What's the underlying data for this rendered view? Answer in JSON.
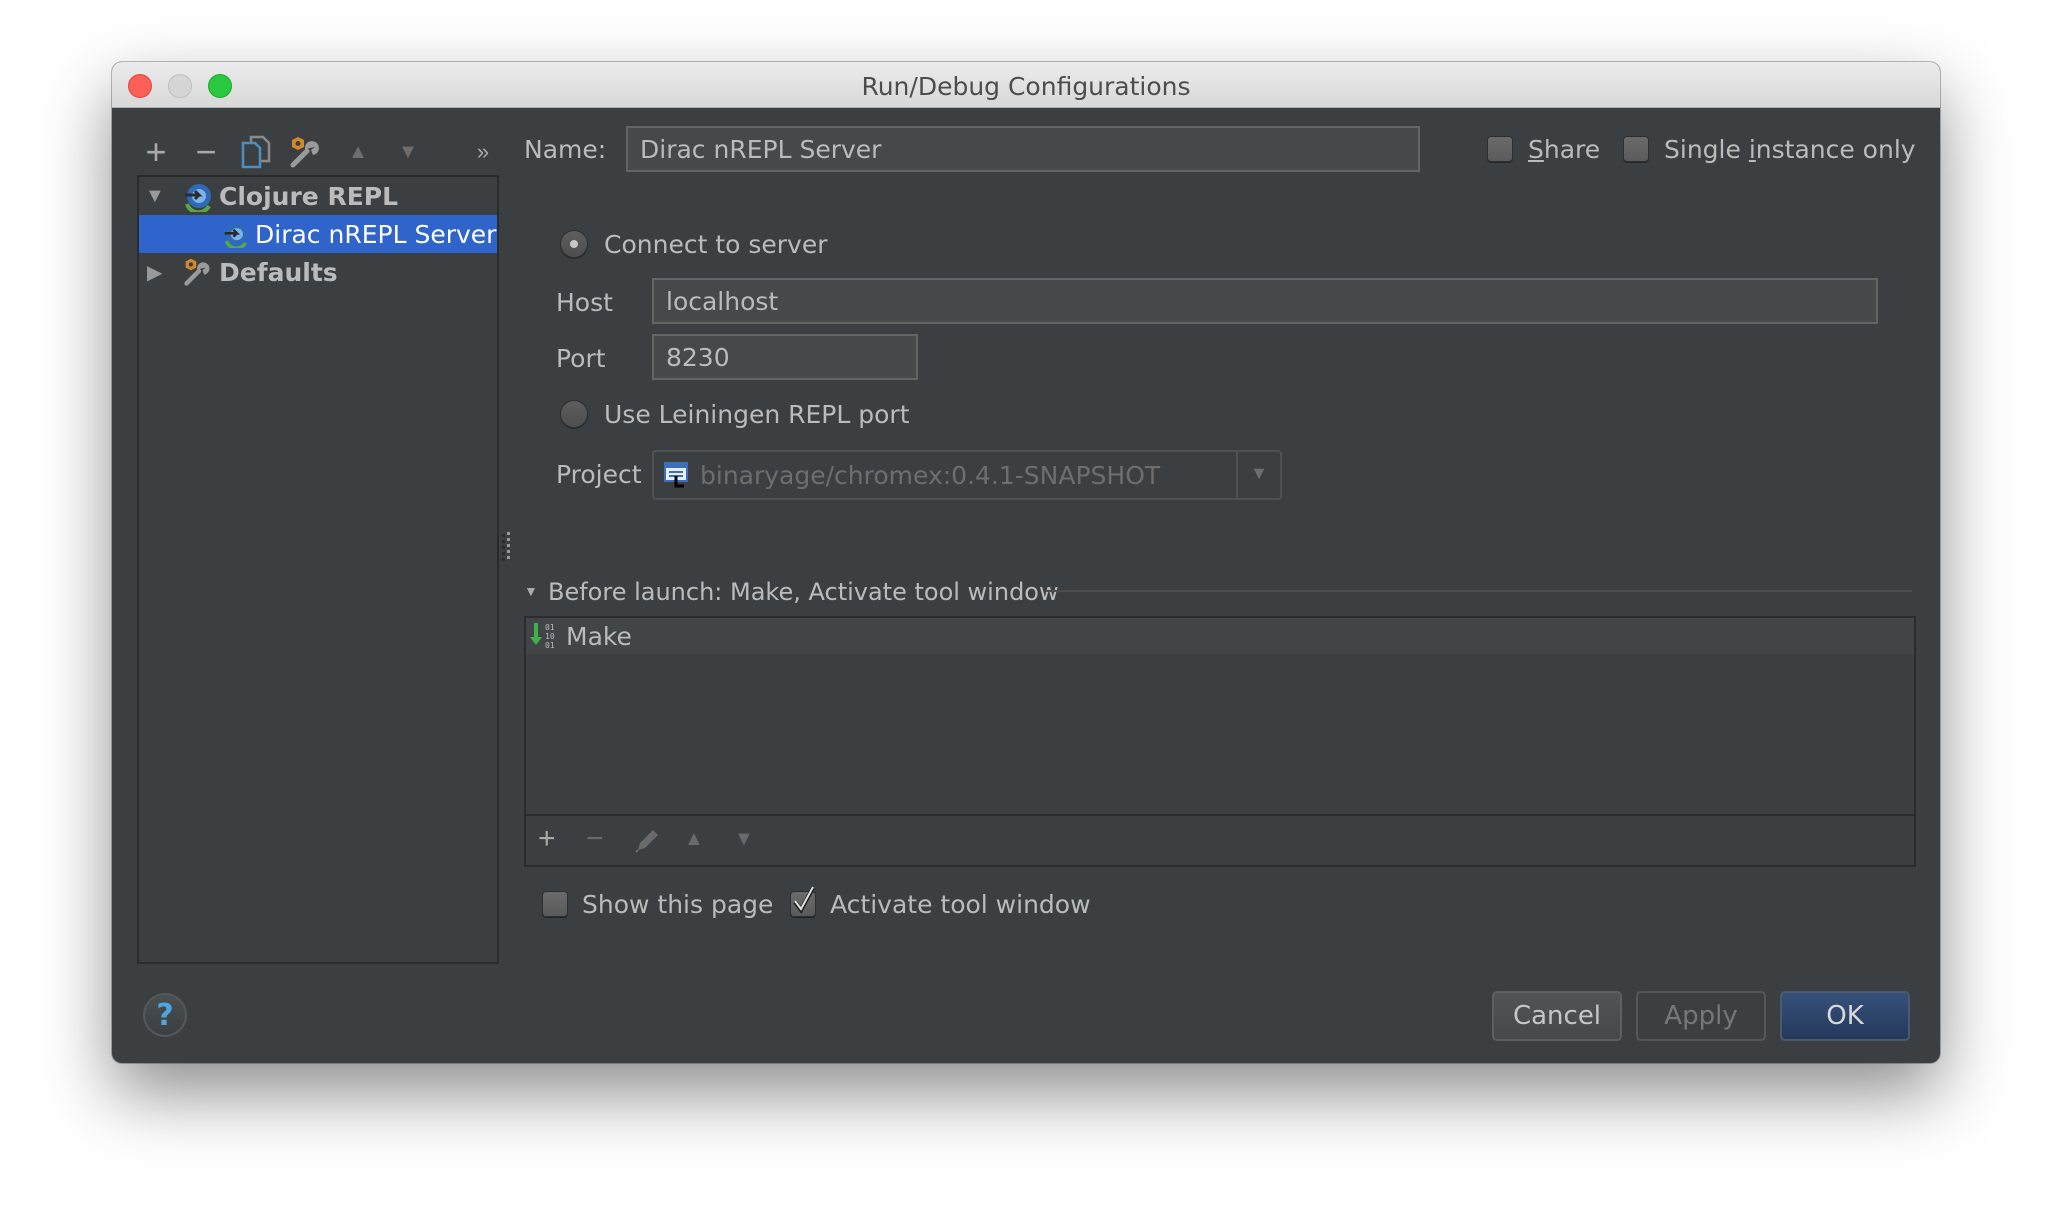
{
  "window": {
    "title": "Run/Debug Configurations"
  },
  "left_toolbar": {
    "items": [
      {
        "name": "add",
        "icon": "plus-icon",
        "glyph": "+"
      },
      {
        "name": "remove",
        "icon": "minus-icon",
        "glyph": "−"
      },
      {
        "name": "copy",
        "icon": "copy-icon"
      },
      {
        "name": "edit-defaults",
        "icon": "wrench-icon"
      },
      {
        "name": "move-up",
        "icon": "arrow-up-icon",
        "glyph": "▲"
      },
      {
        "name": "move-down",
        "icon": "arrow-down-icon",
        "glyph": "▼"
      },
      {
        "name": "more",
        "icon": "chevron-double-right-icon",
        "glyph": "»"
      }
    ]
  },
  "tree": {
    "items": [
      {
        "label": "Clojure REPL",
        "icon": "clojure-repl-icon",
        "expanded": true,
        "bold": true
      },
      {
        "label": "Dirac nREPL Server",
        "icon": "clojure-repl-icon",
        "selected": true
      },
      {
        "label": "Defaults",
        "icon": "wrench-icon",
        "expanded": false,
        "bold": true
      }
    ]
  },
  "form": {
    "name_label": "Name:",
    "name_value": "Dirac nREPL Server",
    "share_label_u": "S",
    "share_label_rest": "hare",
    "share_checked": false,
    "single_instance_label_pre": "Single ",
    "single_instance_label_u": "i",
    "single_instance_label_post": "nstance only",
    "single_instance_checked": false,
    "connect_to_server_label": "Connect to server",
    "connect_to_server_selected": true,
    "host_label": "Host",
    "host_value": "localhost",
    "port_label": "Port",
    "port_value": "8230",
    "use_leiningen_label": "Use Leiningen REPL port",
    "use_leiningen_selected": false,
    "project_label": "Project",
    "project_value": "binaryage/chromex:0.4.1-SNAPSHOT"
  },
  "before_launch": {
    "title": "Before launch: Make, Activate tool window",
    "tasks": [
      {
        "label": "Make",
        "icon": "make-icon"
      }
    ],
    "toolbar": [
      {
        "name": "add",
        "glyph": "+"
      },
      {
        "name": "remove",
        "glyph": "−"
      },
      {
        "name": "edit",
        "icon": "pencil-icon"
      },
      {
        "name": "move-up",
        "glyph": "▲"
      },
      {
        "name": "move-down",
        "glyph": "▼"
      }
    ],
    "show_this_page_label": "Show this page",
    "show_this_page_checked": false,
    "activate_tool_window_label": "Activate tool window",
    "activate_tool_window_checked": true
  },
  "buttons": {
    "cancel": "Cancel",
    "apply": "Apply",
    "ok": "OK",
    "help": "?"
  },
  "colors": {
    "background": "#3c3f41",
    "selection": "#2f65ca",
    "ok_button": "#2d4568",
    "text": "#bbbbbb"
  }
}
